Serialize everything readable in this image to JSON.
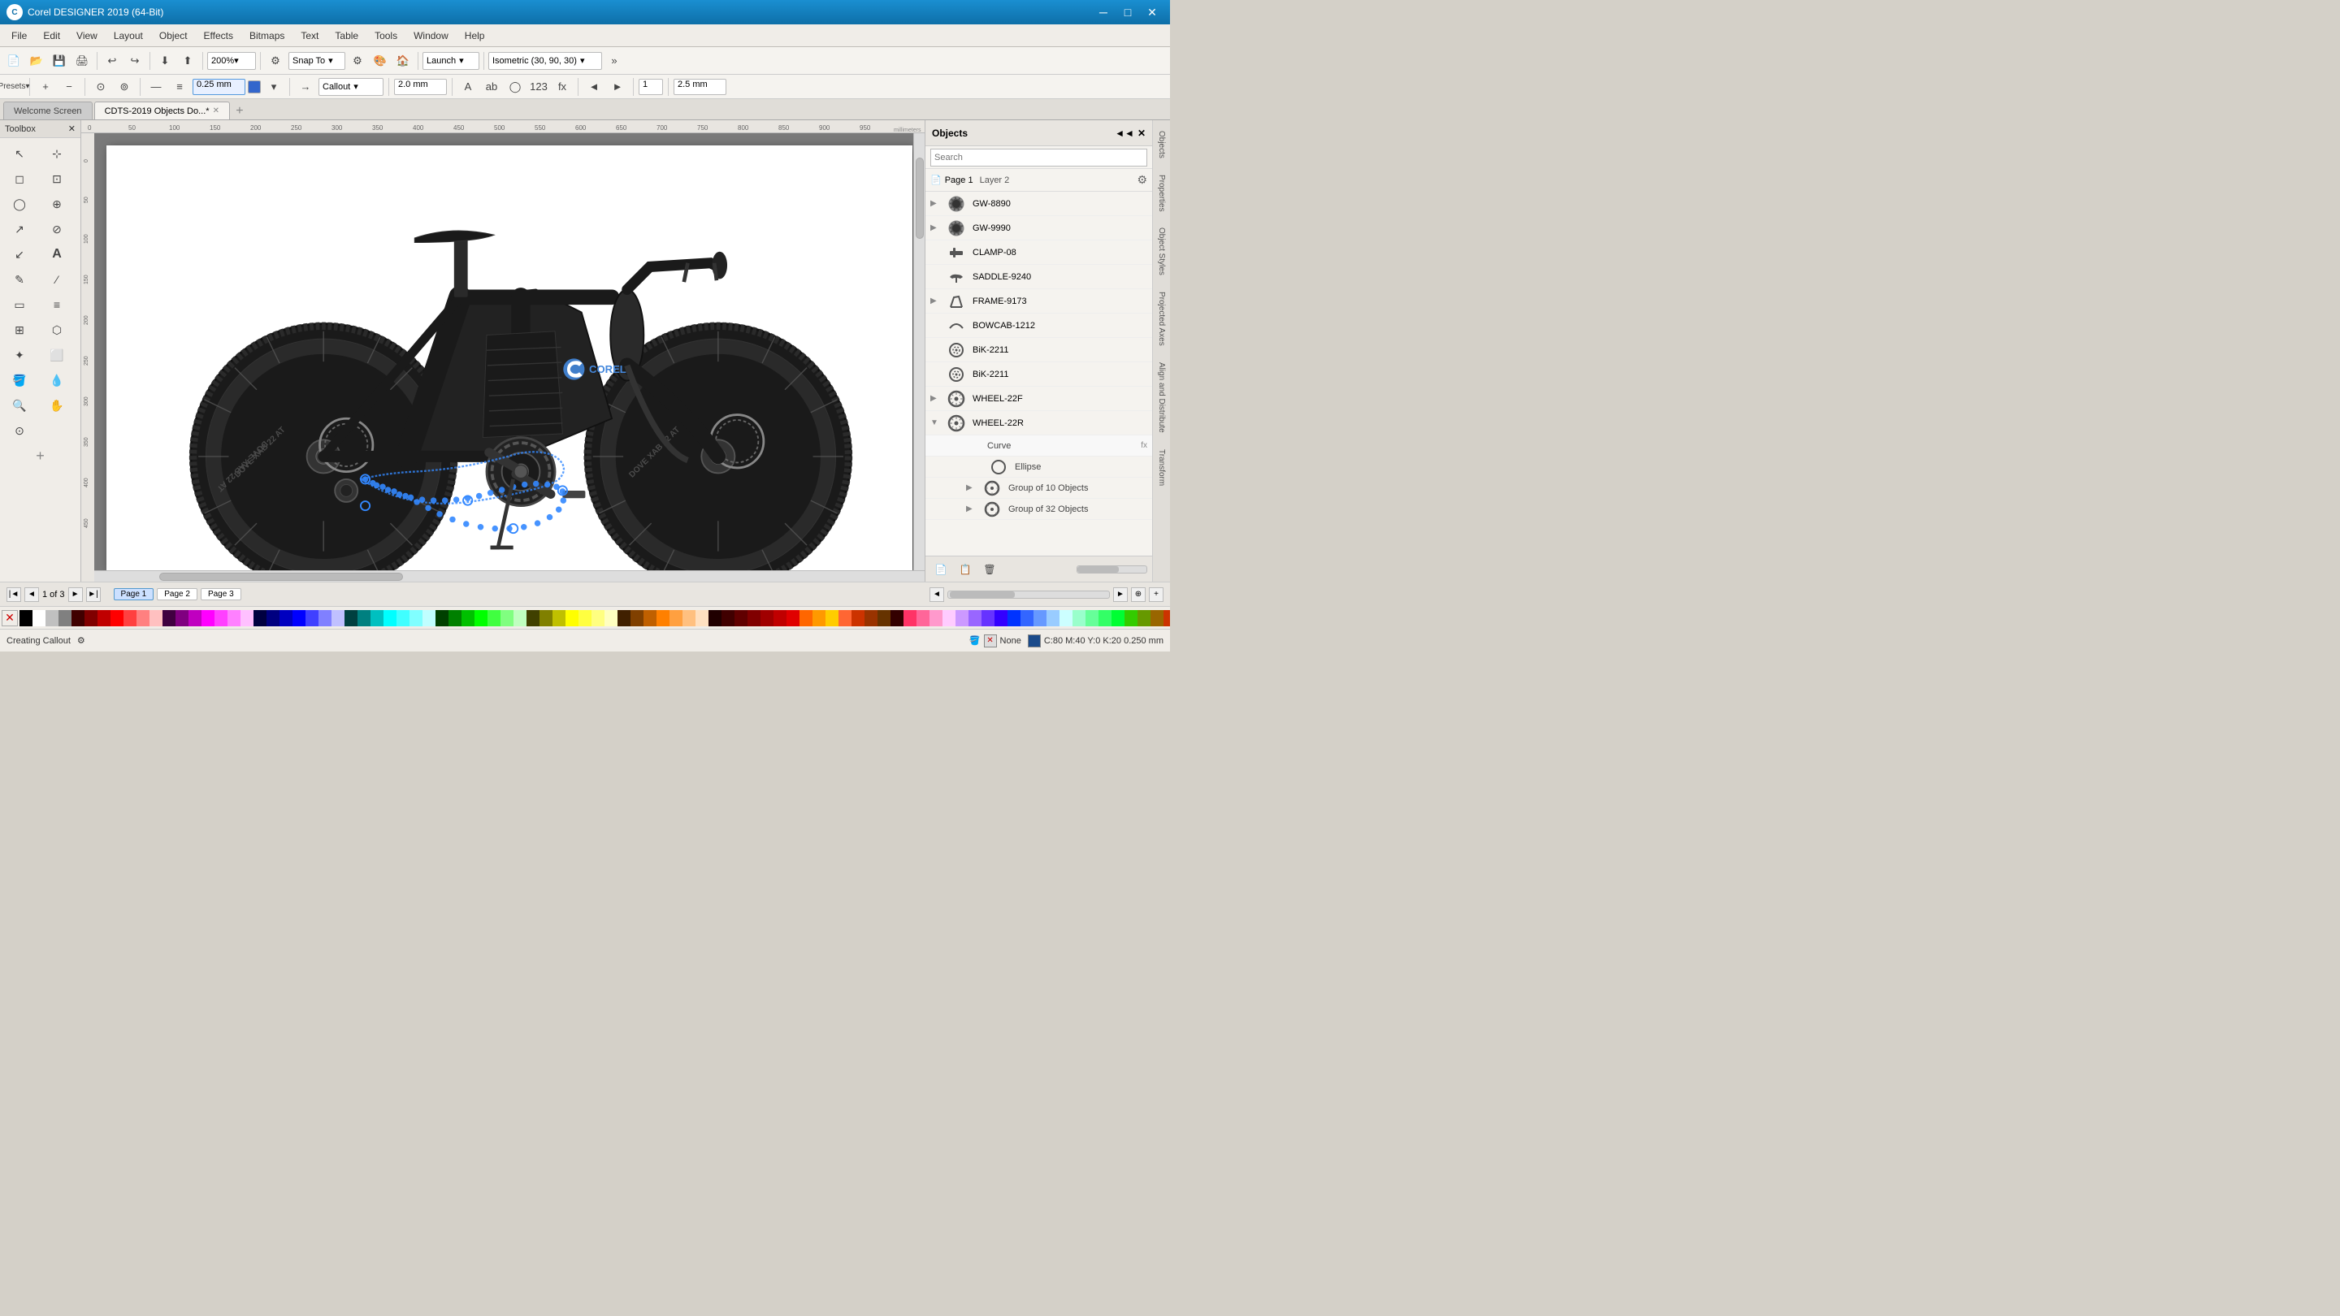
{
  "app": {
    "title": "Corel DESIGNER 2019 (64-Bit)",
    "icon_label": "C"
  },
  "titlebar": {
    "minimize": "─",
    "restore": "□",
    "close": "✕"
  },
  "menu": {
    "items": [
      "File",
      "Edit",
      "View",
      "Layout",
      "Object",
      "Effects",
      "Bitmaps",
      "Text",
      "Table",
      "Tools",
      "Window",
      "Help"
    ]
  },
  "toolbar1": {
    "zoom_value": "200%",
    "snap_label": "Snap To",
    "launch_label": "Launch",
    "isometric_label": "Isometric (30, 90, 30)"
  },
  "toolbar2": {
    "line_width": "0.25 mm",
    "callout_label": "Callout",
    "line_value": "2.0 mm",
    "coord_label": "2.5 mm"
  },
  "tabs": [
    {
      "label": "Welcome Screen",
      "active": false
    },
    {
      "label": "CDTS-2019 Objects Do...*",
      "active": true
    }
  ],
  "toolbox": {
    "title": "Toolbox",
    "tools": [
      "↖",
      "⊹",
      "◻",
      "⊡",
      "◯",
      "⊕",
      "↗",
      "⊘",
      "↙",
      "A",
      "✎",
      "⁄",
      "▭",
      "≡",
      "⊞",
      "⬡",
      "✦",
      "⬜",
      "⊘",
      "✏",
      "🔍",
      "✋",
      "⊙"
    ]
  },
  "objects_panel": {
    "title": "Objects",
    "search_placeholder": "Search",
    "page_label": "Page 1",
    "layer_label": "Layer 2",
    "items": [
      {
        "name": "GW-8890",
        "has_arrow": true,
        "indent": 0
      },
      {
        "name": "GW-9990",
        "has_arrow": true,
        "indent": 0
      },
      {
        "name": "CLAMP-08",
        "has_arrow": false,
        "indent": 0
      },
      {
        "name": "SADDLE-9240",
        "has_arrow": false,
        "indent": 0
      },
      {
        "name": "FRAME-9173",
        "has_arrow": true,
        "indent": 0
      },
      {
        "name": "BOWCAB-1212",
        "has_arrow": false,
        "indent": 0
      },
      {
        "name": "BiK-2211",
        "has_arrow": false,
        "indent": 0
      },
      {
        "name": "BiK-2211",
        "has_arrow": false,
        "indent": 0
      },
      {
        "name": "WHEEL-22F",
        "has_arrow": true,
        "indent": 0
      },
      {
        "name": "WHEEL-22R",
        "has_arrow": true,
        "indent": 0,
        "expanded": true
      },
      {
        "name": "Curve",
        "has_arrow": false,
        "indent": 1,
        "sub": true,
        "has_fx": true
      },
      {
        "name": "Ellipse",
        "has_arrow": false,
        "indent": 1,
        "sub": true
      },
      {
        "name": "Group of 10 Objects",
        "has_arrow": true,
        "indent": 1,
        "sub": true
      },
      {
        "name": "Group of 32 Objects",
        "has_arrow": true,
        "indent": 1,
        "sub": true
      }
    ]
  },
  "right_tabs": [
    "Objects",
    "Properties",
    "Object Styles",
    "Projected Axes",
    "Align and Distribute",
    "Transform"
  ],
  "statusbar": {
    "status_text": "Creating Callout",
    "fill_label": "None",
    "color_info": "C:80 M:40 Y:0 K:20  0.250 mm"
  },
  "page_nav": {
    "current": "1 of 3",
    "pages": [
      "Page 1",
      "Page 2",
      "Page 3"
    ]
  },
  "palette": {
    "colors": [
      "#000000",
      "#ffffff",
      "#c0c0c0",
      "#808080",
      "#400000",
      "#800000",
      "#c00000",
      "#ff0000",
      "#ff4040",
      "#ff8080",
      "#ffc0c0",
      "#400040",
      "#800080",
      "#c000c0",
      "#ff00ff",
      "#ff40ff",
      "#ff80ff",
      "#ffc0ff",
      "#000040",
      "#000080",
      "#0000c0",
      "#0000ff",
      "#4040ff",
      "#8080ff",
      "#c0c0ff",
      "#004040",
      "#008080",
      "#00c0c0",
      "#00ffff",
      "#40ffff",
      "#80ffff",
      "#c0ffff",
      "#004000",
      "#008000",
      "#00c000",
      "#00ff00",
      "#40ff40",
      "#80ff80",
      "#c0ffc0",
      "#404000",
      "#808000",
      "#c0c000",
      "#ffff00",
      "#ffff40",
      "#ffff80",
      "#ffffc0",
      "#402000",
      "#804000",
      "#c06000",
      "#ff8000",
      "#ffa040",
      "#ffc080",
      "#ffe0c0",
      "#200000",
      "#400000",
      "#600000",
      "#800000",
      "#a00000",
      "#c00000",
      "#e00000",
      "#ff6600",
      "#ff9900",
      "#ffcc00",
      "#ff6633",
      "#cc3300",
      "#993300",
      "#663300",
      "#330000",
      "#ff3366",
      "#ff6699",
      "#ff99cc",
      "#ffccff",
      "#cc99ff",
      "#9966ff",
      "#6633ff",
      "#3300ff",
      "#0033ff",
      "#3366ff",
      "#6699ff",
      "#99ccff",
      "#ccffff",
      "#99ffcc",
      "#66ff99",
      "#33ff66",
      "#00ff33",
      "#33cc00",
      "#669900",
      "#996600",
      "#cc3300"
    ]
  }
}
